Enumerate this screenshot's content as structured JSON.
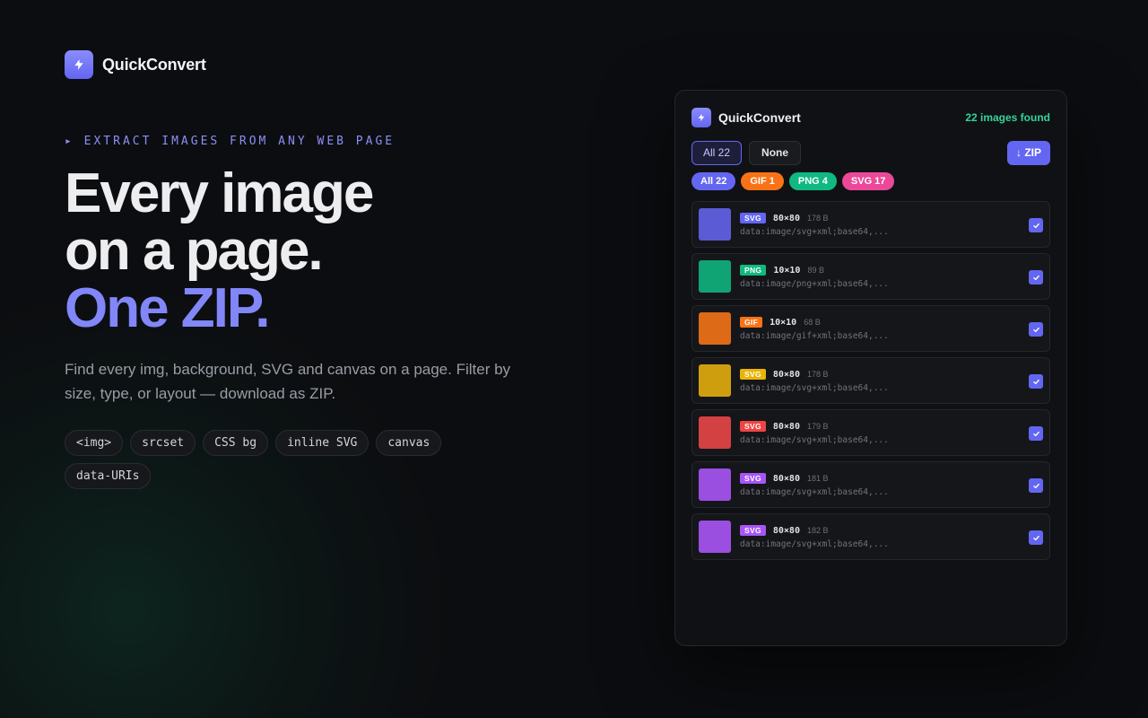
{
  "brand": {
    "name": "QuickConvert",
    "icon": "bolt-icon"
  },
  "hero": {
    "eyebrow": "▸ EXTRACT IMAGES FROM ANY WEB PAGE",
    "headline_line1": "Every image",
    "headline_line2": "on a page.",
    "headline_accent": "One ZIP.",
    "description": "Find every img, background, SVG and canvas on a page. Filter by size, type, or layout — download as ZIP.",
    "chips": [
      "<img>",
      "srcset",
      "CSS bg",
      "inline SVG",
      "canvas",
      "data-URIs"
    ]
  },
  "panel": {
    "title": "QuickConvert",
    "found": "22 images found",
    "select_all": "All 22",
    "select_none": "None",
    "zip_label": "↓ ZIP",
    "filters": [
      {
        "label": "All 22",
        "color": "#6366f1"
      },
      {
        "label": "GIF 1",
        "color": "#f97316"
      },
      {
        "label": "PNG 4",
        "color": "#10b981"
      },
      {
        "label": "SVG 17",
        "color": "#ec4899"
      }
    ],
    "items": [
      {
        "type": "SVG",
        "type_color": "#6366f1",
        "thumb_color": "#5b5bd6",
        "dims": "80×80",
        "size": "178 B",
        "uri": "data:image/svg+xml;base64,...",
        "checked": true
      },
      {
        "type": "PNG",
        "type_color": "#10b981",
        "thumb_color": "#10a373",
        "dims": "10×10",
        "size": "89 B",
        "uri": "data:image/png+xml;base64,...",
        "checked": true
      },
      {
        "type": "GIF",
        "type_color": "#f97316",
        "thumb_color": "#dd6a17",
        "dims": "10×10",
        "size": "68 B",
        "uri": "data:image/gif+xml;base64,...",
        "checked": true
      },
      {
        "type": "SVG",
        "type_color": "#eab308",
        "thumb_color": "#cf9e0f",
        "dims": "80×80",
        "size": "178 B",
        "uri": "data:image/svg+xml;base64,...",
        "checked": true
      },
      {
        "type": "SVG",
        "type_color": "#ef4444",
        "thumb_color": "#d44142",
        "dims": "80×80",
        "size": "179 B",
        "uri": "data:image/svg+xml;base64,...",
        "checked": true
      },
      {
        "type": "SVG",
        "type_color": "#a855f7",
        "thumb_color": "#9a4fe0",
        "dims": "80×80",
        "size": "181 B",
        "uri": "data:image/svg+xml;base64,...",
        "checked": true
      },
      {
        "type": "SVG",
        "type_color": "#a855f7",
        "thumb_color": "#9a4fe0",
        "dims": "80×80",
        "size": "182 B",
        "uri": "data:image/svg+xml;base64,...",
        "checked": true
      }
    ]
  }
}
